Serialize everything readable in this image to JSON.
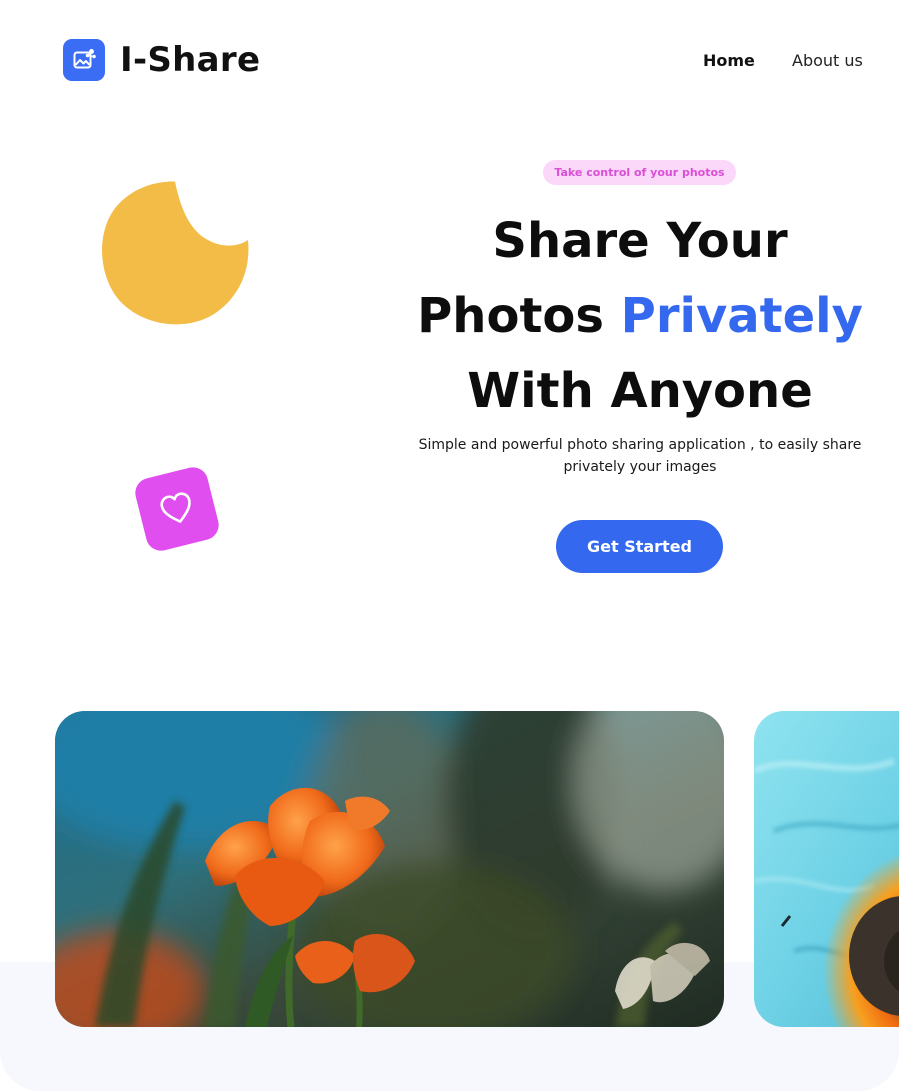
{
  "header": {
    "logo_text": "I-Share",
    "logo_icon": "image-share-icon",
    "nav": {
      "home": "Home",
      "about": "About us"
    }
  },
  "hero": {
    "badge": "Take control of your photos",
    "title_line1": "Share Your",
    "title_line2_prefix": "Photos",
    "title_line2_accent": "Privately",
    "title_line3": "With Anyone",
    "subtitle": "Simple and powerful photo sharing application , to easily share privately your images",
    "cta_label": "Get Started"
  },
  "decorations": {
    "moon": "crescent-moon-shape",
    "heart": "heart-icon"
  },
  "gallery": {
    "photos": [
      {
        "subject": "orange tulips photo"
      },
      {
        "subject": "abstract blue and orange texture photo"
      }
    ]
  },
  "colors": {
    "brand_blue": "#3368ef",
    "logo_blue": "#3b6cf4",
    "badge_bg": "#fbd7fa",
    "badge_text": "#d94fd6",
    "moon_yellow": "#f2bc46",
    "heart_pink": "#e04ef0",
    "gallery_bg": "#f6f8fe"
  }
}
